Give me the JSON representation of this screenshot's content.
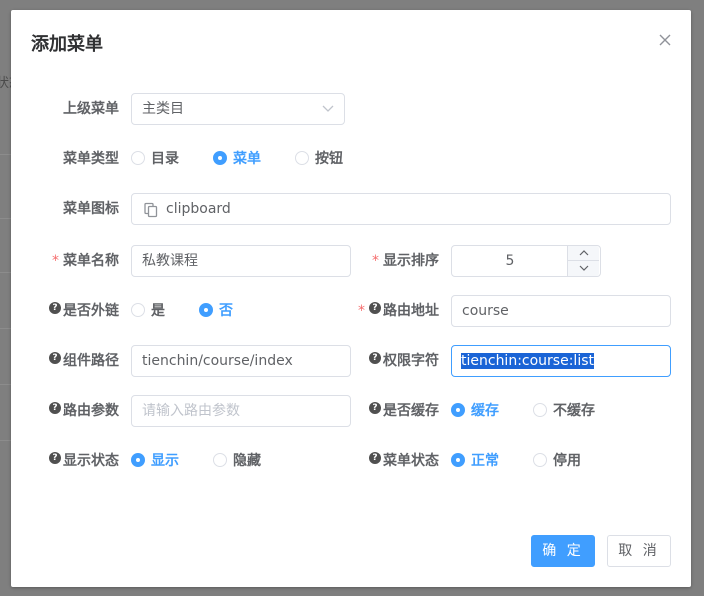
{
  "background": {
    "fragment": "状态"
  },
  "dialog": {
    "title": "添加菜单",
    "close_icon": "close-icon"
  },
  "form": {
    "parent_menu": {
      "label": "上级菜单",
      "value": "主类目"
    },
    "menu_type": {
      "label": "菜单类型",
      "options": [
        "目录",
        "菜单",
        "按钮"
      ],
      "selected": "菜单"
    },
    "menu_icon": {
      "label": "菜单图标",
      "value": "clipboard",
      "icon": "clipboard-icon"
    },
    "menu_name": {
      "label": "菜单名称",
      "value": "私教课程"
    },
    "display_order": {
      "label": "显示排序",
      "value": "5"
    },
    "is_external": {
      "label": "是否外链",
      "options": [
        "是",
        "否"
      ],
      "selected": "否"
    },
    "route_path": {
      "label": "路由地址",
      "value": "course"
    },
    "component_path": {
      "label": "组件路径",
      "value": "tienchin/course/index"
    },
    "permission": {
      "label": "权限字符",
      "value": "tienchin:course:list"
    },
    "route_params": {
      "label": "路由参数",
      "placeholder": "请输入路由参数"
    },
    "is_cache": {
      "label": "是否缓存",
      "options": [
        "缓存",
        "不缓存"
      ],
      "selected": "缓存"
    },
    "visible": {
      "label": "显示状态",
      "options": [
        "显示",
        "隐藏"
      ],
      "selected": "显示"
    },
    "status": {
      "label": "菜单状态",
      "options": [
        "正常",
        "停用"
      ],
      "selected": "正常"
    }
  },
  "footer": {
    "confirm": "确 定",
    "cancel": "取 消"
  },
  "colors": {
    "primary": "#409eff",
    "required": "#f56c6c",
    "border": "#dcdfe6",
    "selection": "#1a64d6"
  }
}
